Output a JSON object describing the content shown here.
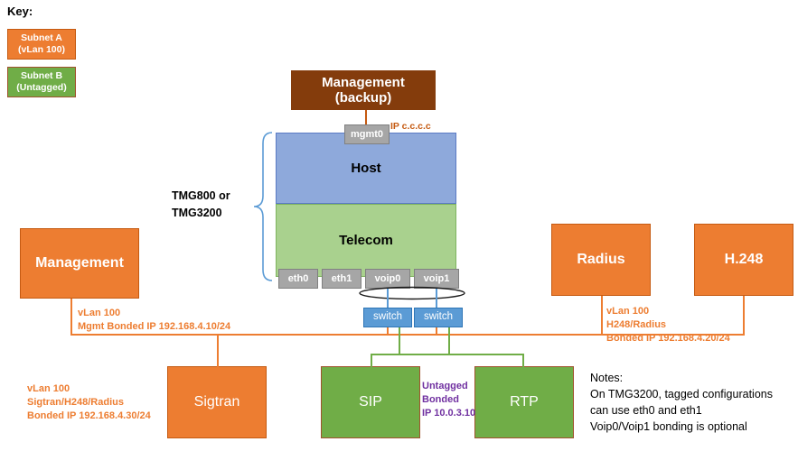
{
  "key": {
    "title": "Key:",
    "items": [
      {
        "name": "Subnet A",
        "detail": "(vLan 100)",
        "color": "#ED7D31"
      },
      {
        "name": "Subnet B",
        "detail": "(Untagged)",
        "color": "#70AD47"
      }
    ]
  },
  "nodes": {
    "management_backup": "Management\n(backup)",
    "management_backup_line1": "Management",
    "management_backup_line2": "(backup)",
    "host": "Host",
    "telecom": "Telecom",
    "management": "Management",
    "radius": "Radius",
    "h248": "H.248",
    "sigtran": "Sigtran",
    "sip": "SIP",
    "rtp": "RTP"
  },
  "interfaces": {
    "mgmt0": "mgmt0",
    "eth0": "eth0",
    "eth1": "eth1",
    "voip0": "voip0",
    "voip1": "voip1",
    "switch_left": "switch",
    "switch_right": "switch"
  },
  "annotations": {
    "chassis_label": "TMG800 or\nTMG3200",
    "chassis_line1": "TMG800 or",
    "chassis_line2": "TMG3200",
    "mgmt0_ip": "IP c.c.c.c",
    "mgmt_subnet_line1": "vLan 100",
    "mgmt_subnet_line2": "Mgmt Bonded IP 192.168.4.10/24",
    "right_subnet_line1": "vLan 100",
    "right_subnet_line2": "H248/Radius",
    "right_subnet_line3": "Bonded IP 192.168.4.20/24",
    "sigtran_subnet_line1": "vLan 100",
    "sigtran_subnet_line2": "Sigtran/H248/Radius",
    "sigtran_subnet_line3": "Bonded IP 192.168.4.30/24",
    "untagged_line1": "Untagged",
    "untagged_line2": "Bonded",
    "untagged_line3": "IP 10.0.3.10"
  },
  "notes": {
    "heading": "Notes:",
    "line1": "On TMG3200,  tagged configurations",
    "line2": "can use eth0 and eth1",
    "line3": "Voip0/Voip1 bonding is optional"
  },
  "colors": {
    "subnet_a": "#ED7D31",
    "subnet_b": "#70AD47",
    "host": "#8EA9DB",
    "telecom": "#A9D18E",
    "management_backup": "#843C0C",
    "interface": "#A6A6A6",
    "switch": "#5B9BD5",
    "untagged_text": "#7030A0"
  }
}
